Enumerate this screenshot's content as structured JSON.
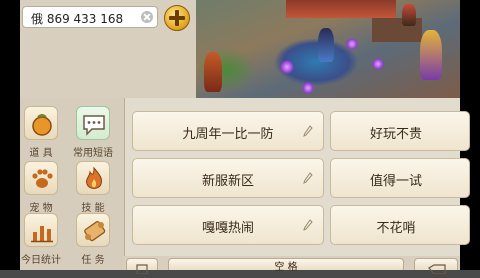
{
  "chat": {
    "input_value": "俄 869 433 168",
    "clear_icon": "clear-x-icon",
    "add_icon": "plus-icon"
  },
  "sidebar": {
    "items": [
      {
        "label": "道 具",
        "icon": "bag-icon"
      },
      {
        "label": "常用短语",
        "icon": "chat-bubble-icon"
      },
      {
        "label": "宠 物",
        "icon": "paw-icon"
      },
      {
        "label": "技 能",
        "icon": "flame-icon"
      },
      {
        "label": "今日统计",
        "icon": "bar-chart-icon"
      },
      {
        "label": "任 务",
        "icon": "scroll-icon"
      }
    ]
  },
  "phrases": [
    {
      "text": "九周年一比一防"
    },
    {
      "text": "好玩不贵"
    },
    {
      "text": "新服新区"
    },
    {
      "text": "值得一试"
    },
    {
      "text": "嘎嘎热闹"
    },
    {
      "text": "不花哨"
    }
  ],
  "bottom": {
    "space_label": "空 格"
  },
  "colors": {
    "accent": "#e0a21a",
    "panel_bg": "#e2dccf",
    "selected_tool": "#d4ebcf"
  }
}
